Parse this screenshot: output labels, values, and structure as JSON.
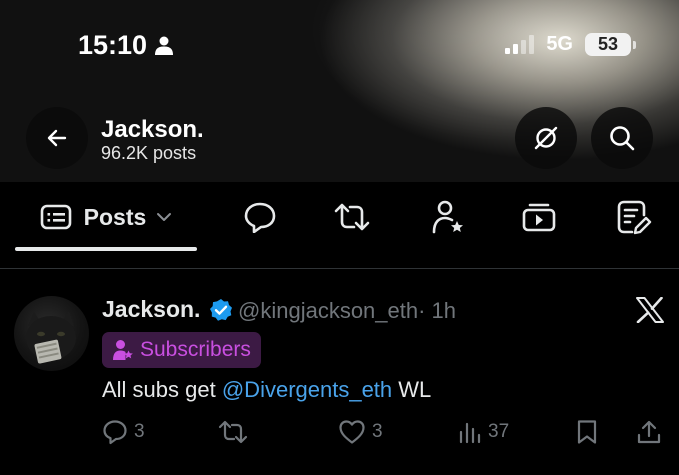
{
  "status_bar": {
    "time": "15:10",
    "network": "5G",
    "battery": "53"
  },
  "profile": {
    "name": "Jackson.",
    "posts_count": "96.2K posts"
  },
  "tabs": [
    {
      "label": "Posts",
      "icon": "posts-list-icon",
      "active": true
    },
    {
      "icon": "replies-bubble-icon"
    },
    {
      "icon": "repost-icon"
    },
    {
      "icon": "subscribers-person-star-icon"
    },
    {
      "icon": "video-icon"
    },
    {
      "icon": "articles-edit-icon"
    }
  ],
  "tweet": {
    "author_name": "Jackson.",
    "handle": "@kingjackson_eth",
    "time": "· 1h",
    "badge": "Subscribers",
    "text_prefix": "All subs get ",
    "mention": "@Divergents_eth",
    "text_suffix": " WL",
    "actions": {
      "replies": "3",
      "reposts": "",
      "likes": "3",
      "views": "37"
    }
  },
  "colors": {
    "accent": "#4aa3ea",
    "badge_text": "#c94fe0",
    "badge_bg": "#3c1a44",
    "muted": "#71767b"
  }
}
